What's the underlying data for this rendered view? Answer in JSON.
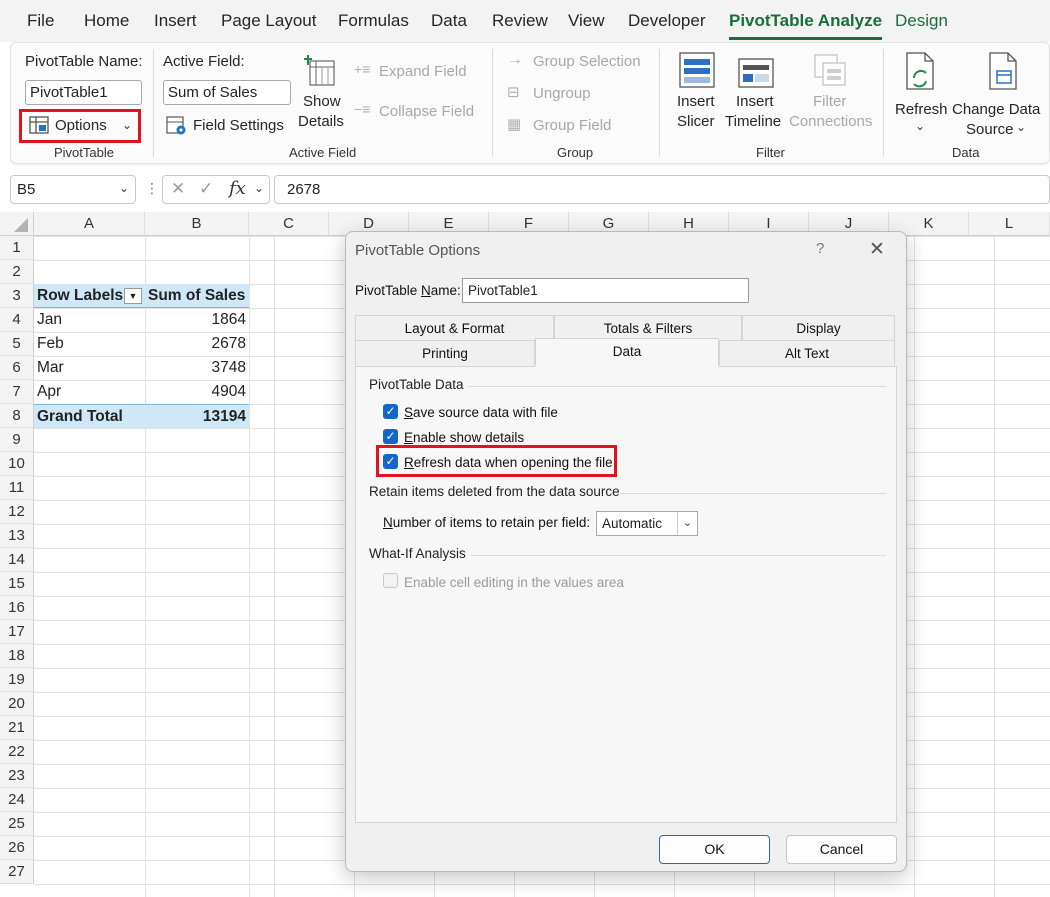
{
  "menu_tabs": [
    "File",
    "Home",
    "Insert",
    "Page Layout",
    "Formulas",
    "Data",
    "Review",
    "View",
    "Developer",
    "PivotTable Analyze",
    "Design"
  ],
  "ribbon": {
    "pivottable": {
      "name_label": "PivotTable Name:",
      "name_value": "PivotTable1",
      "options_label": "Options",
      "group_label": "PivotTable"
    },
    "active_field": {
      "label": "Active Field:",
      "value": "Sum of Sales",
      "field_settings": "Field Settings",
      "show_details_line1": "Show",
      "show_details_line2": "Details",
      "expand_field": "Expand Field",
      "collapse_field": "Collapse Field",
      "group_label": "Active Field"
    },
    "group": {
      "group_selection": "Group Selection",
      "ungroup": "Ungroup",
      "group_field": "Group Field",
      "group_label": "Group"
    },
    "filter": {
      "insert_slicer_1": "Insert",
      "insert_slicer_2": "Slicer",
      "insert_timeline_1": "Insert",
      "insert_timeline_2": "Timeline",
      "filter_connections_1": "Filter",
      "filter_connections_2": "Connections",
      "group_label": "Filter"
    },
    "data": {
      "refresh": "Refresh",
      "change_source_1": "Change Data",
      "change_source_2": "Source",
      "group_label": "Data"
    }
  },
  "formula_bar": {
    "name_box": "B5",
    "fx": "fx",
    "formula": "2678"
  },
  "sheet": {
    "columns": [
      "A",
      "B",
      "C",
      "D",
      "E",
      "F",
      "G",
      "H",
      "I",
      "J",
      "K",
      "L"
    ],
    "rows": [
      "1",
      "2",
      "3",
      "4",
      "5",
      "6",
      "7",
      "8",
      "9",
      "10",
      "11",
      "12",
      "13",
      "14",
      "15",
      "16",
      "17",
      "18",
      "19",
      "20",
      "21",
      "22",
      "23",
      "24",
      "25",
      "26",
      "27"
    ],
    "pivot": {
      "header_labels": "Row Labels",
      "header_values": "Sum of Sales",
      "items": [
        {
          "label": "Jan",
          "value": "1864"
        },
        {
          "label": "Feb",
          "value": "2678"
        },
        {
          "label": "Mar",
          "value": "3748"
        },
        {
          "label": "Apr",
          "value": "4904"
        }
      ],
      "total_label": "Grand Total",
      "total_value": "13194"
    }
  },
  "dialog": {
    "title": "PivotTable Options",
    "help": "?",
    "close": "✕",
    "name_label_pre": "PivotTable ",
    "name_label_u": "N",
    "name_label_post": "ame:",
    "name_value": "PivotTable1",
    "tabs_top": [
      "Layout & Format",
      "Totals & Filters",
      "Display"
    ],
    "tabs_bottom": [
      "Printing",
      "Data",
      "Alt Text"
    ],
    "active_tab": "Data",
    "section_pivot_data": "PivotTable Data",
    "save_source_u": "S",
    "save_source_rest": "ave source data with file",
    "enable_details_u": "E",
    "enable_details_rest": "nable show details",
    "refresh_on_open_u": "R",
    "refresh_on_open_rest": "efresh data when opening the file",
    "section_retain": "Retain items deleted from the data source",
    "retain_label_u": "N",
    "retain_label_rest": "umber of items to retain per field:",
    "retain_value": "Automatic",
    "section_whatif": "What-If Analysis",
    "enable_editing": "Enable cell editing in the values area",
    "ok": "OK",
    "cancel": "Cancel"
  },
  "colors": {
    "accent_green": "#1a6e3a",
    "highlight_red": "#e0141e",
    "checkbox_blue": "#1467c9",
    "pivot_header_blue": "#cfe8f7"
  }
}
